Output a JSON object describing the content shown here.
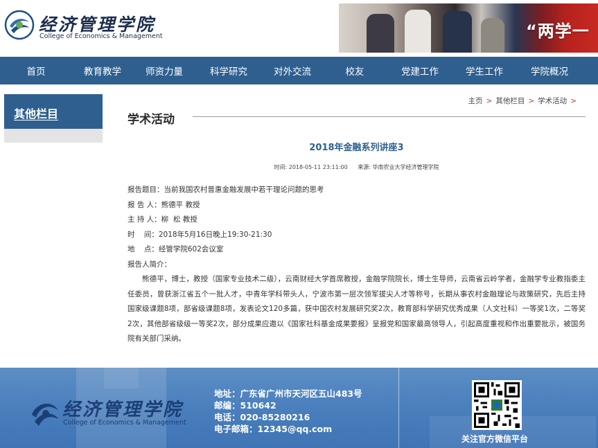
{
  "header": {
    "logo_cn": "经济管理学院",
    "logo_en": "College of Economics & Management",
    "banner_text": "“两学一"
  },
  "nav": {
    "items": [
      {
        "label": "首页"
      },
      {
        "label": "教育教学"
      },
      {
        "label": "师资力量"
      },
      {
        "label": "科学研究"
      },
      {
        "label": "对外交流"
      },
      {
        "label": "校友"
      },
      {
        "label": "党建工作"
      },
      {
        "label": "学生工作"
      },
      {
        "label": "学院概况"
      }
    ]
  },
  "sidebar": {
    "title": "其他栏目"
  },
  "breadcrumb": {
    "items": [
      "主页",
      "其他栏目",
      "学术活动"
    ],
    "separator": ">"
  },
  "section": {
    "title": "学术活动"
  },
  "article": {
    "title": "2018年金融系列讲座3",
    "time": "时间: 2018-05-11 23:11:00",
    "source": "来源: 华南农业大学经济管理学院",
    "lines": [
      "报告题目：当前我国农村普惠金融发展中若干理论问题的思考",
      "报 告 人：熊德平 教授",
      "主 持 人：柳  松 教授",
      "时    间：2018年5月16日晚上19:30-21:30",
      "地    点：经管学院602会议室",
      "报告人简介："
    ],
    "bio": "熊德平，博士，教授（国家专业技术二级），云南财经大学首席教授，金融学院院长，博士生导师，云南省云岭学者，金融学专业教指委主任委员，曾获浙江省五个一批人才，中青年学科带头人，宁波市第一层次领军拔尖人才等称号，长期从事农村金融理论与政策研究，先后主持国家级课题8项，部省级课题8项，发表论文120多篇，获中国农村发展研究奖2次，教育部科学研究优秀成果（人文社科）一等奖1次，二等奖2次，其他部省级级一等奖2次，部分成果应邀以《国家社科基金成果要报》呈报党和国家最高领导人，引起高度重视和作出重要批示，被国务院有关部门采纳。"
  },
  "footer": {
    "logo_cn": "经济管理学院",
    "logo_en": "College of Economics & Management",
    "address": "地址：广东省广州市天河区五山483号",
    "postcode": "邮编：510642",
    "phone": "电话：020-85280216",
    "email": "电子邮箱：12345@qq.com",
    "qr_caption": "关注官方微信平台"
  },
  "colors": {
    "nav_bg": "#2e5f8f",
    "title_blue": "#2e5f8f",
    "breadcrumb_sep": "#c0392b",
    "footer_bg": "#4a7fbe"
  }
}
